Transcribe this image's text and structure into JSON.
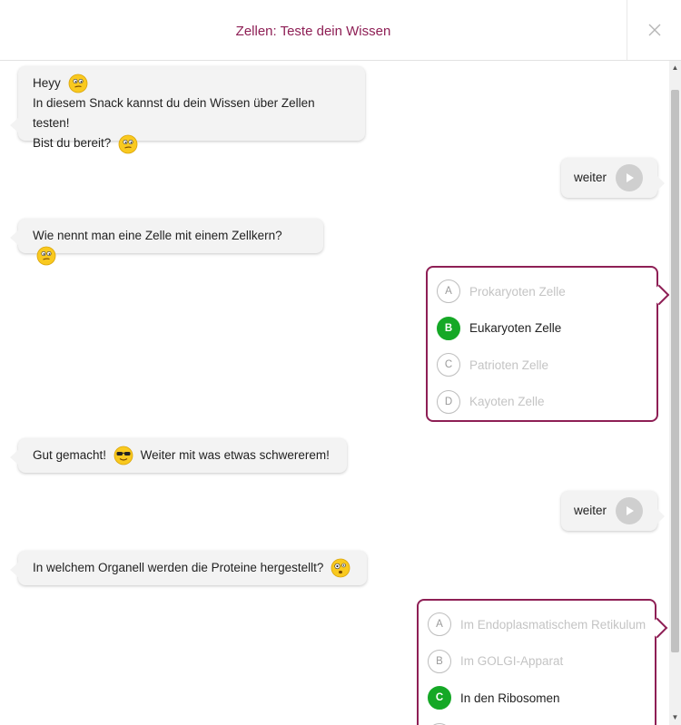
{
  "header": {
    "title": "Zellen: Teste dein Wissen"
  },
  "intro": {
    "line1": "Heyy",
    "line2": "In diesem Snack kannst du dein Wissen über Zellen testen!",
    "line3": "Bist du bereit?"
  },
  "weiter_label": "weiter",
  "question1": {
    "text": "Wie nennt man eine Zelle mit einem Zellkern?",
    "options": [
      {
        "letter": "A",
        "text": "Prokaryoten Zelle"
      },
      {
        "letter": "B",
        "text": "Eukaryoten Zelle"
      },
      {
        "letter": "C",
        "text": "Patrioten Zelle"
      },
      {
        "letter": "D",
        "text": "Kayoten Zelle"
      }
    ]
  },
  "feedback1": {
    "before": "Gut gemacht!",
    "after": "Weiter mit was etwas schwererem!"
  },
  "question2": {
    "text": "In welchem Organell werden die Proteine hergestellt?",
    "options": [
      {
        "letter": "A",
        "text": "Im Endoplasmatischem Retikulum"
      },
      {
        "letter": "B",
        "text": "Im GOLGI-Apparat"
      },
      {
        "letter": "C",
        "text": "In den Ribosomen"
      },
      {
        "letter": "D",
        "text": ""
      }
    ]
  },
  "icons": {
    "close": "close-icon",
    "play": "play-icon",
    "emoji": [
      "thinking-emoji",
      "sunglasses-emoji",
      "confused-emoji"
    ]
  },
  "colors": {
    "accent": "#8e1f55",
    "correct": "#15a826",
    "bubble": "#f3f3f3",
    "play_button": "#cfcfcf"
  }
}
